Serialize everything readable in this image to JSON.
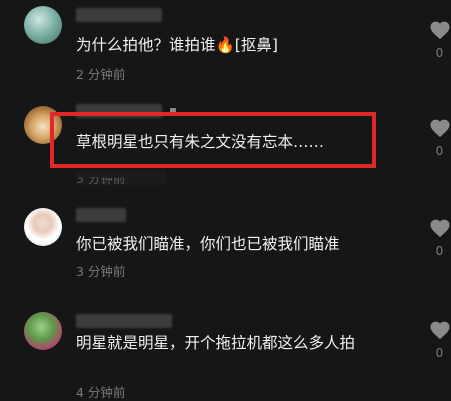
{
  "comments": [
    {
      "text": "为什么拍他？谁拍谁🔥[抠鼻]",
      "time": "2 分钟前",
      "likes": "0",
      "like_icon": "heart-icon"
    },
    {
      "text": "草根明星也只有朱之文没有忘本……",
      "time": "3 分钟前",
      "likes": "0",
      "like_icon": "heart-icon"
    },
    {
      "text": "你已被我们瞄准，你们也已被我们瞄准",
      "time": "3 分钟前",
      "likes": "0",
      "like_icon": "heart-icon"
    },
    {
      "text": "明星就是明星，开个拖拉机都这么多人拍",
      "time": "4 分钟前",
      "likes": "0",
      "like_icon": "heart-icon"
    }
  ],
  "colors": {
    "highlight": "#e0282a",
    "background": "#161616"
  }
}
